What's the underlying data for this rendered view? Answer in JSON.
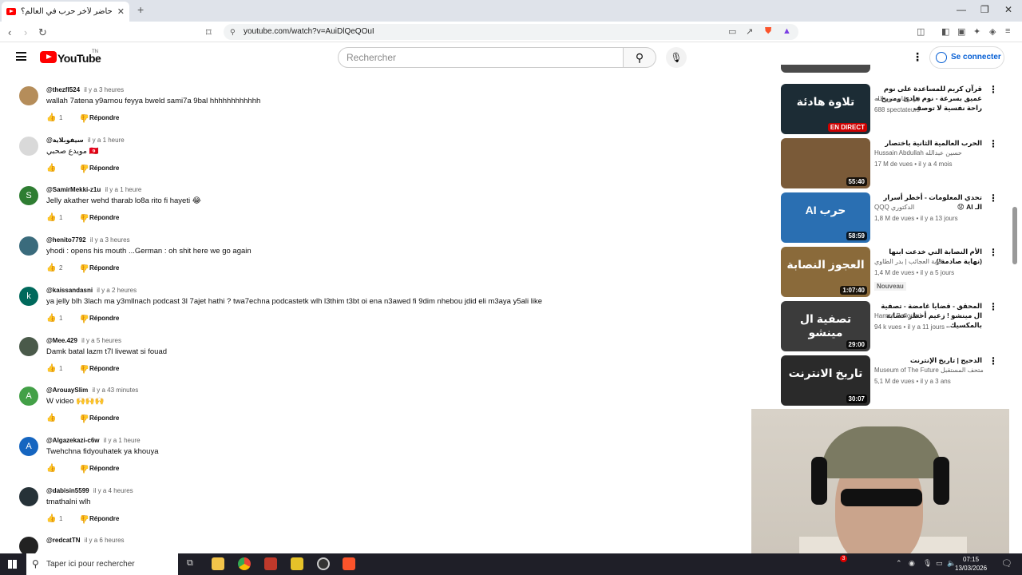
{
  "browser": {
    "tab_title": "حاضر لأخر حرب في العالم؟ Tube",
    "tab_close": "✕",
    "new_tab": "+",
    "url": "youtube.com/watch?v=AuiDlQeQOuI"
  },
  "header": {
    "logo_text": "YouTube",
    "country": "TN",
    "search_placeholder": "Rechercher",
    "signin_label": "Se connecter"
  },
  "comments": [
    {
      "handle": "@thezfl524",
      "time": "il y a 3 heures",
      "text": "wallah 7atena y9arnou feyya bweld sami7a 9bal hhhhhhhhhhhh",
      "likes": "1",
      "reply": "Répondre",
      "avatar_letter": "",
      "avatar_color": "#b58d5a"
    },
    {
      "handle": "@سيفوبلاية",
      "time": "il y a 1 heure",
      "text": "مويدع صحبي 🇹🇳",
      "likes": "",
      "reply": "Répondre",
      "avatar_letter": "",
      "avatar_color": "#d9d9d9"
    },
    {
      "handle": "@SamirMekki-z1u",
      "time": "il y a 1 heure",
      "text": "Jelly akather wehd tharab lo8a rito fi hayeti 😂",
      "likes": "1",
      "reply": "Répondre",
      "avatar_letter": "S",
      "avatar_color": "#2e7d32"
    },
    {
      "handle": "@henito7792",
      "time": "il y a 3 heures",
      "text": "yhodi : opens his mouth ...German : oh shit here we go again",
      "likes": "2",
      "reply": "Répondre",
      "avatar_letter": "",
      "avatar_color": "#3a6b7c"
    },
    {
      "handle": "@kaissandasni",
      "time": "il y a 2 heures",
      "text": "ya jelly blh 3lach ma y3mllnach podcast 3l 7ajet hathi ? twa7echna podcastetk wlh l3thim t3bt oi ena n3awed fi 9dim nhebou jdid eli m3aya y5ali like",
      "likes": "1",
      "reply": "Répondre",
      "avatar_letter": "k",
      "avatar_color": "#00695c"
    },
    {
      "handle": "@Mee.429",
      "time": "il y a 5 heures",
      "text": "Damk batal lazm t7l livewat si fouad",
      "likes": "1",
      "reply": "Répondre",
      "avatar_letter": "",
      "avatar_color": "#4a5a4a"
    },
    {
      "handle": "@ArouaySlim",
      "time": "il y a 43 minutes",
      "text": "W video 🙌🙌🙌",
      "likes": "",
      "reply": "Répondre",
      "avatar_letter": "A",
      "avatar_color": "#43a047"
    },
    {
      "handle": "@Algazekazi-c6w",
      "time": "il y a 1 heure",
      "text": "Twehchna fidyouhatek ya khouya",
      "likes": "",
      "reply": "Répondre",
      "avatar_letter": "A",
      "avatar_color": "#1565c0"
    },
    {
      "handle": "@dabisin5599",
      "time": "il y a 4 heures",
      "text": "tmathalni wlh",
      "likes": "1",
      "reply": "Répondre",
      "avatar_letter": "",
      "avatar_color": "#263238"
    },
    {
      "handle": "@redcatTN",
      "time": "il y a 6 heures",
      "text": "",
      "likes": "",
      "reply": "",
      "avatar_letter": "",
      "avatar_color": "#222222"
    }
  ],
  "sidebar": [
    {
      "title": "قرآن كريم للمساعدة على نوم عميق بسرعة - نوم هادئ ومريح - راحة نفسية لا توصف",
      "channel": "في رحاب نور الله",
      "stats": "688 spectateurs",
      "duration": "EN DIRECT",
      "live": true,
      "thumb": "#1c2c35",
      "thumb_text": "تلاوة هادئة"
    },
    {
      "title": "الحرب العالمية الثانية باختصار",
      "channel": "Hussain Abdullah حسين عبدالله",
      "stats": "17 M de vues • il y a 4 mois",
      "duration": "55:40",
      "live": false,
      "thumb": "#7a5a38",
      "thumb_text": ""
    },
    {
      "title": "تحدي المعلومات - أخطر أسرار الـ AI 😟",
      "channel": "QQQ الدكتوري",
      "stats": "1,8 M de vues • il y a 13 jours",
      "duration": "58:59",
      "live": false,
      "thumb": "#2a6fb2",
      "thumb_text": "حرب AI"
    },
    {
      "title": "الأم النصابة التي خدعت ابنها (نهاية صادمة!)",
      "channel": "قرية العجائب | بدر الطاوي",
      "stats": "1,4 M de vues • il y a 5 jours",
      "duration": "1:07:40",
      "live": false,
      "thumb": "#8a6a3a",
      "thumb_text": "العجوز النصابة",
      "badge": "Nouveau"
    },
    {
      "title": "المحقق - قضايا غامضة - تصفية ال مينشو ! زعيم أخطر عصابة بالمكسيك..",
      "channel": "Hamza Belloumi",
      "stats": "94 k vues • il y a 11 jours",
      "duration": "29:00",
      "live": false,
      "thumb": "#3b3b3b",
      "thumb_text": "تصفية ال مينشو"
    },
    {
      "title": "الدحيح | تاريخ الإنترنت",
      "channel": "Museum of The Future متحف المستقبل",
      "stats": "5,1 M de vues • il y a 3 ans",
      "duration": "30:07",
      "live": false,
      "thumb": "#2a2a2a",
      "thumb_text": "تاريخ الانترنت"
    }
  ],
  "taskbar": {
    "search_placeholder": "Taper ici pour rechercher",
    "time": "07:15",
    "date": "13/03/2026",
    "notif_count": "3"
  }
}
